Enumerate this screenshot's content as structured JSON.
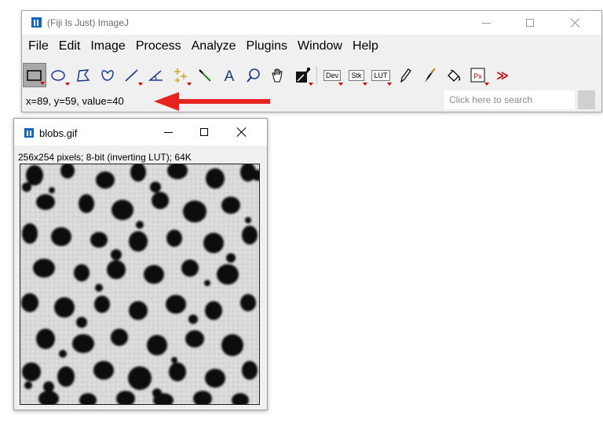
{
  "main_window": {
    "title": "(Fiji Is Just) ImageJ",
    "menu": [
      "File",
      "Edit",
      "Image",
      "Process",
      "Analyze",
      "Plugins",
      "Window",
      "Help"
    ],
    "tools": [
      {
        "name": "rectangle-tool",
        "icon": "rectangle-icon",
        "selected": true
      },
      {
        "name": "oval-tool",
        "icon": "oval-icon"
      },
      {
        "name": "polygon-tool",
        "icon": "polygon-icon"
      },
      {
        "name": "freehand-tool",
        "icon": "freehand-icon"
      },
      {
        "name": "line-tool",
        "icon": "line-icon"
      },
      {
        "name": "angle-tool",
        "icon": "angle-icon"
      },
      {
        "name": "point-tool",
        "icon": "point-icon"
      },
      {
        "name": "wand-tool",
        "icon": "wand-icon"
      },
      {
        "name": "text-tool",
        "icon": "text-icon",
        "label": "A"
      },
      {
        "name": "zoom-tool",
        "icon": "magnifier-icon"
      },
      {
        "name": "hand-tool",
        "icon": "hand-icon"
      },
      {
        "name": "color-picker-tool",
        "icon": "color-picker-icon"
      },
      {
        "name": "dev-menu",
        "label": "Dev"
      },
      {
        "name": "stk-menu",
        "label": "Stk"
      },
      {
        "name": "lut-menu",
        "label": "LUT"
      },
      {
        "name": "pencil-tool",
        "icon": "pencil-icon"
      },
      {
        "name": "brush-tool",
        "icon": "brush-icon"
      },
      {
        "name": "flood-fill-tool",
        "icon": "paint-bucket-icon"
      },
      {
        "name": "pixel-inspector-tool",
        "icon": "pixel-inspector-icon",
        "label": "Px"
      },
      {
        "name": "more-tools",
        "icon": "double-chevron-right-icon",
        "label": "≫"
      }
    ],
    "status": "x=89, y=59, value=40",
    "search_placeholder": "Click here to search"
  },
  "image_window": {
    "title": "blobs.gif",
    "info": "256x254 pixels; 8-bit (inverting LUT); 64K"
  },
  "colors": {
    "annotation_arrow": "#e8231f",
    "logo_blue": "#1565c0",
    "tool_dropdown_marker": "#d00000",
    "blob_dark": "#0a0a0a",
    "image_background": "#d8d8d8"
  }
}
